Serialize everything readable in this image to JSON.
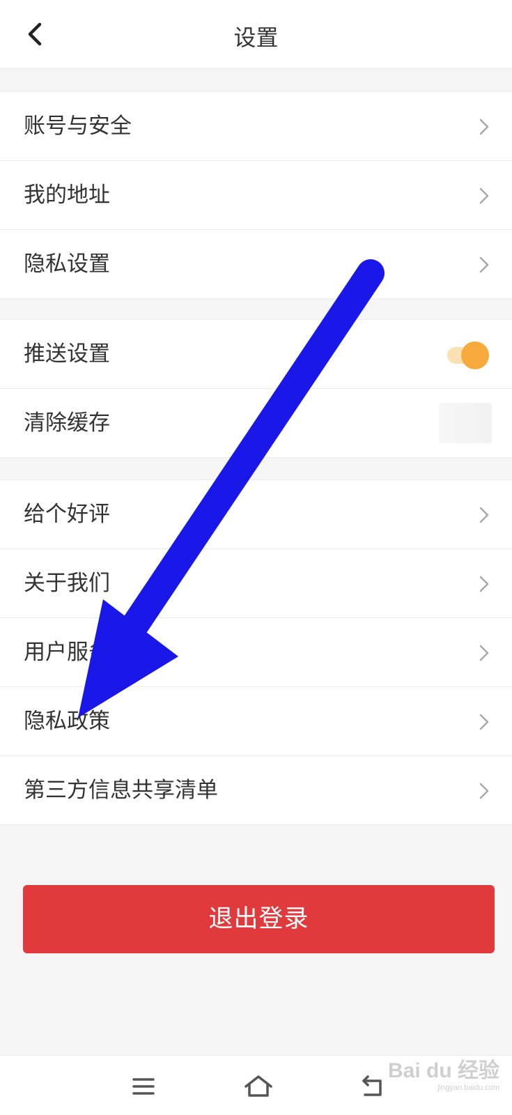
{
  "header": {
    "title": "设置"
  },
  "groups": [
    {
      "items": [
        {
          "label": "账号与安全",
          "control": "chevron"
        },
        {
          "label": "我的地址",
          "control": "chevron"
        },
        {
          "label": "隐私设置",
          "control": "chevron"
        }
      ]
    },
    {
      "items": [
        {
          "label": "推送设置",
          "control": "toggle",
          "enabled": true
        },
        {
          "label": "清除缓存",
          "control": "value"
        }
      ]
    },
    {
      "items": [
        {
          "label": "给个好评",
          "control": "chevron"
        },
        {
          "label": "关于我们",
          "control": "chevron"
        },
        {
          "label": "用户服务协议",
          "control": "chevron"
        },
        {
          "label": "隐私政策",
          "control": "chevron"
        },
        {
          "label": "第三方信息共享清单",
          "control": "chevron"
        }
      ]
    }
  ],
  "logout": {
    "label": "退出登录"
  },
  "navbar": {
    "icons": [
      "menu-icon",
      "home-icon",
      "back-nav-icon"
    ]
  },
  "watermark": {
    "logo": "Bai du 经验",
    "url": "jingyan.baidu.com"
  },
  "colors": {
    "accent_red": "#e03a3c",
    "toggle_on": "#f7a93b",
    "annotation_arrow": "#1a18e8",
    "text_primary": "#333333",
    "background": "#f5f5f5"
  }
}
